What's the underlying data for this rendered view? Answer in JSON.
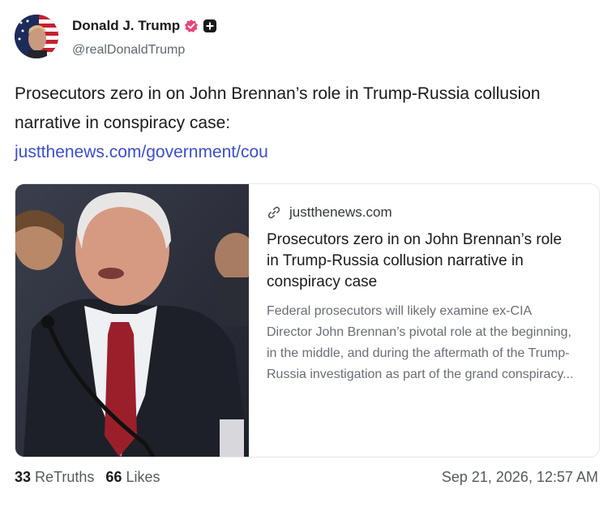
{
  "author": {
    "display_name": "Donald J. Trump",
    "handle": "@realDonaldTrump",
    "avatar_icon": "avatar-flag-portrait",
    "verified_icon": "verified-badge-icon",
    "verified_color": "#e8447a",
    "plus_icon": "plus-icon"
  },
  "post": {
    "text": "Prosecutors zero in on John Brennan’s role in Trump-Russia collusion narrative in conspiracy case:",
    "link_text": "justthenews.com/government/cou",
    "link_color": "#3b4fc6"
  },
  "link_card": {
    "image_icon": "news-photo",
    "domain": "justthenews.com",
    "domain_icon": "link-icon",
    "title": "Prosecutors zero in on John Brennan’s role in Trump-Russia collusion narrative in conspiracy case",
    "description": "Federal prosecutors will likely examine ex-CIA Director John Brennan’s pivotal role at the beginning, in the middle, and during the aftermath of the Trump-Russia investigation as part of the grand conspiracy..."
  },
  "stats": {
    "retruths_count": "33",
    "retruths_label": "ReTruths",
    "likes_count": "66",
    "likes_label": "Likes"
  },
  "timestamp": "Sep 21, 2026, 12:57 AM"
}
